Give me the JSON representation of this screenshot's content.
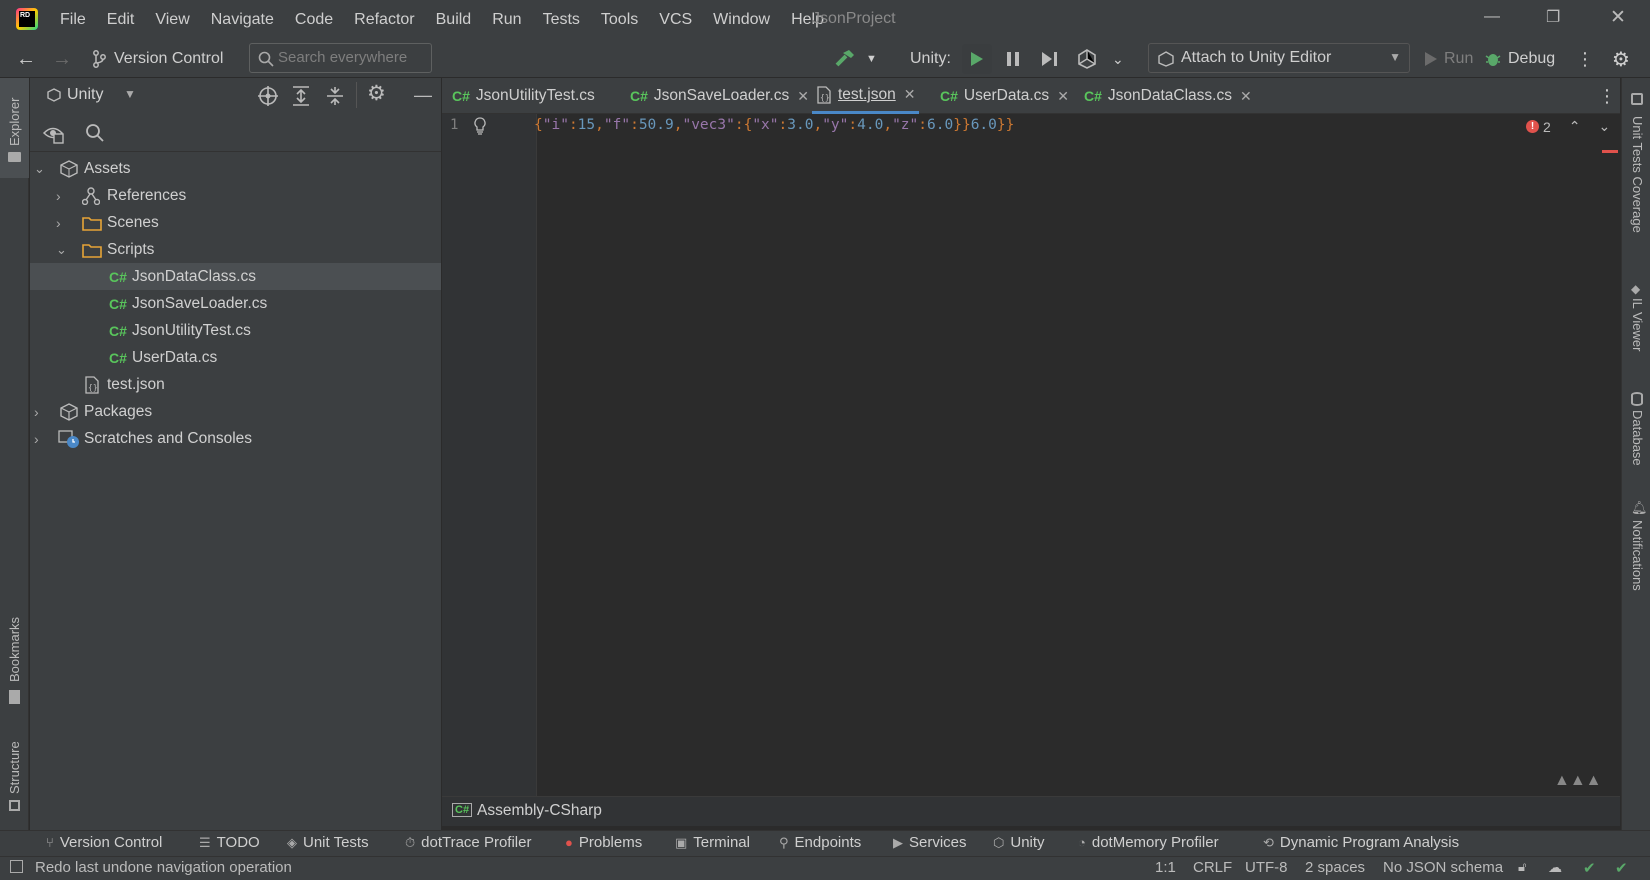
{
  "menubar": {
    "items": [
      "File",
      "Edit",
      "View",
      "Navigate",
      "Code",
      "Refactor",
      "Build",
      "Run",
      "Tests",
      "Tools",
      "VCS",
      "Window",
      "Help"
    ],
    "project_title": "JsonProject"
  },
  "toolbar": {
    "version_control": "Version Control",
    "search_placeholder": "Search everywhere",
    "unity_label": "Unity:",
    "attach_label": "Attach to Unity Editor",
    "run_label": "Run",
    "debug_label": "Debug"
  },
  "explorer": {
    "scope": "Unity",
    "tree": [
      {
        "label": "Assets",
        "level": 0,
        "expanded": true,
        "icon": "unity-folder-icon"
      },
      {
        "label": "References",
        "level": 1,
        "expanded": false,
        "icon": "references-icon"
      },
      {
        "label": "Scenes",
        "level": 1,
        "expanded": false,
        "icon": "folder-icon"
      },
      {
        "label": "Scripts",
        "level": 1,
        "expanded": true,
        "icon": "folder-icon"
      },
      {
        "label": "JsonDataClass.cs",
        "level": 2,
        "icon": "csharp-icon",
        "selected": true
      },
      {
        "label": "JsonSaveLoader.cs",
        "level": 2,
        "icon": "csharp-icon"
      },
      {
        "label": "JsonUtilityTest.cs",
        "level": 2,
        "icon": "csharp-icon"
      },
      {
        "label": "UserData.cs",
        "level": 2,
        "icon": "csharp-icon"
      },
      {
        "label": "test.json",
        "level": 1,
        "icon": "json-file-icon"
      },
      {
        "label": "Packages",
        "level": 0,
        "expanded": false,
        "icon": "packages-icon"
      },
      {
        "label": "Scratches and Consoles",
        "level": 0,
        "expanded": false,
        "icon": "scratches-icon"
      }
    ],
    "cs_badge": "C#"
  },
  "tabs": [
    {
      "label": "JsonUtilityTest.cs",
      "icon": "csharp"
    },
    {
      "label": "JsonSaveLoader.cs",
      "icon": "csharp"
    },
    {
      "label": "test.json",
      "icon": "json",
      "active": true
    },
    {
      "label": "UserData.cs",
      "icon": "csharp"
    },
    {
      "label": "JsonDataClass.cs",
      "icon": "csharp"
    }
  ],
  "editor": {
    "line_number": "1",
    "code": "{\"i\":15,\"f\":50.9,\"vec3\":{\"x\":3.0,\"y\":4.0,\"z\":6.0}}6.0}}",
    "error_count": "2"
  },
  "breadcrumb": "Assembly-CSharp",
  "left_strip": {
    "explorer": "Explorer",
    "bookmarks": "Bookmarks",
    "structure": "Structure"
  },
  "right_strip": {
    "unit_tests": "Unit Tests Coverage",
    "il_viewer": "IL Viewer",
    "database": "Database",
    "notifications": "Notifications"
  },
  "tool_windows": [
    "Version Control",
    "TODO",
    "Unit Tests",
    "dotTrace Profiler",
    "Problems",
    "Terminal",
    "Endpoints",
    "Services",
    "Unity",
    "dotMemory Profiler",
    "Dynamic Program Analysis"
  ],
  "status": {
    "message": "Redo last undone navigation operation",
    "position": "1:1",
    "line_sep": "CRLF",
    "encoding": "UTF-8",
    "indent": "2 spaces",
    "schema": "No JSON schema"
  }
}
